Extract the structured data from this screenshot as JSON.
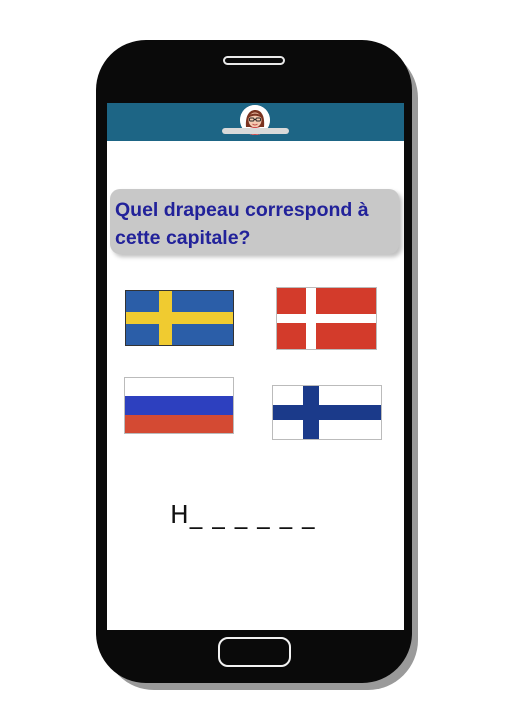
{
  "quiz": {
    "question": "Quel drapeau correspond à cette capitale?",
    "answer_hint": "H_ _ _ _ _ _"
  },
  "flags": [
    {
      "icon": "sweden-flag-icon",
      "colors": {
        "field": "#2b5ea8",
        "cross": "#f0cb30"
      }
    },
    {
      "icon": "denmark-flag-icon",
      "colors": {
        "field": "#d33b2b",
        "cross": "#ffffff"
      }
    },
    {
      "icon": "russia-flag-icon",
      "colors": {
        "top": "#ffffff",
        "middle": "#2d40bf",
        "bottom": "#d44a33"
      }
    },
    {
      "icon": "finland-flag-icon",
      "colors": {
        "field": "#ffffff",
        "cross": "#1b3a8a"
      }
    }
  ],
  "header": {
    "avatar_icon": "user-avatar-icon",
    "accent_color": "#1d6585"
  }
}
